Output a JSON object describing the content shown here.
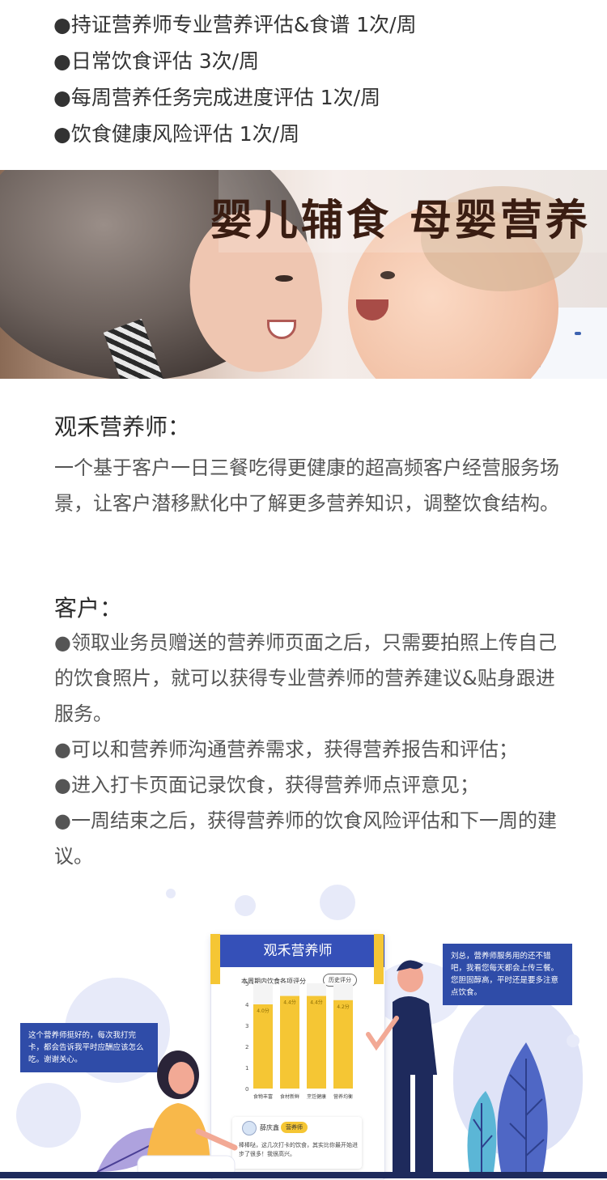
{
  "top_list": {
    "items": [
      "●持证营养师专业营养评估&食谱 1次/周",
      "●日常饮食评估 3次/周",
      "●每周营养任务完成进度评估 1次/周",
      "●饮食健康风险评估 1次/周"
    ]
  },
  "banner": {
    "title": "婴儿辅食  母婴营养"
  },
  "intro": {
    "title": "观禾营养师：",
    "body": "一个基于客户一日三餐吃得更健康的超高频客户经营服务场景，让客户潜移默化中了解更多营养知识，调整饮食结构。"
  },
  "customer": {
    "title": "客户：",
    "items": [
      "●领取业务员赠送的营养师页面之后，只需要拍照上传自己的饮食照片，就可以获得专业营养师的营养建议&贴身跟进服务。",
      "●可以和营养师沟通营养需求，获得营养报告和评估；",
      "●进入打卡页面记录饮食，获得营养师点评意见；",
      "●一周结束之后，获得营养师的饮食风险评估和下一周的建议。"
    ]
  },
  "illustration": {
    "app_title": "观禾营养师",
    "chart_subtitle": "本周期内饮食各项评分",
    "history_button": "历史评分",
    "bubble_left": "这个营养师挺好的，每次我打完卡，都会告诉我平时应酬应该怎么吃。谢谢关心。",
    "bubble_right": "刘总，营养师服务用的还不错吧，我看您每天都会上传三餐。您胆固醇高，平时还是要多注意点饮食。",
    "user_name": "薛庆鑫",
    "user_tag": "营养师",
    "user_msg": "棒棒哒，这几次打卡的饮食，其实比你最开始进步了很多！我很高兴。",
    "colors": {
      "primary": "#3550b8",
      "bar": "#f5c634",
      "bubble": "#2f4ca8"
    }
  },
  "chart_data": {
    "type": "bar",
    "categories": [
      "食物丰富",
      "食材新鲜",
      "烹饪健康",
      "营养均衡"
    ],
    "values": [
      4.0,
      4.4,
      4.4,
      4.2
    ],
    "data_labels": [
      "4.0分",
      "4.4分",
      "4.4分",
      "4.2分"
    ],
    "yticks": [
      "0",
      "1",
      "2",
      "3",
      "4",
      "5"
    ],
    "ylim": [
      0,
      5
    ],
    "grid": false
  }
}
